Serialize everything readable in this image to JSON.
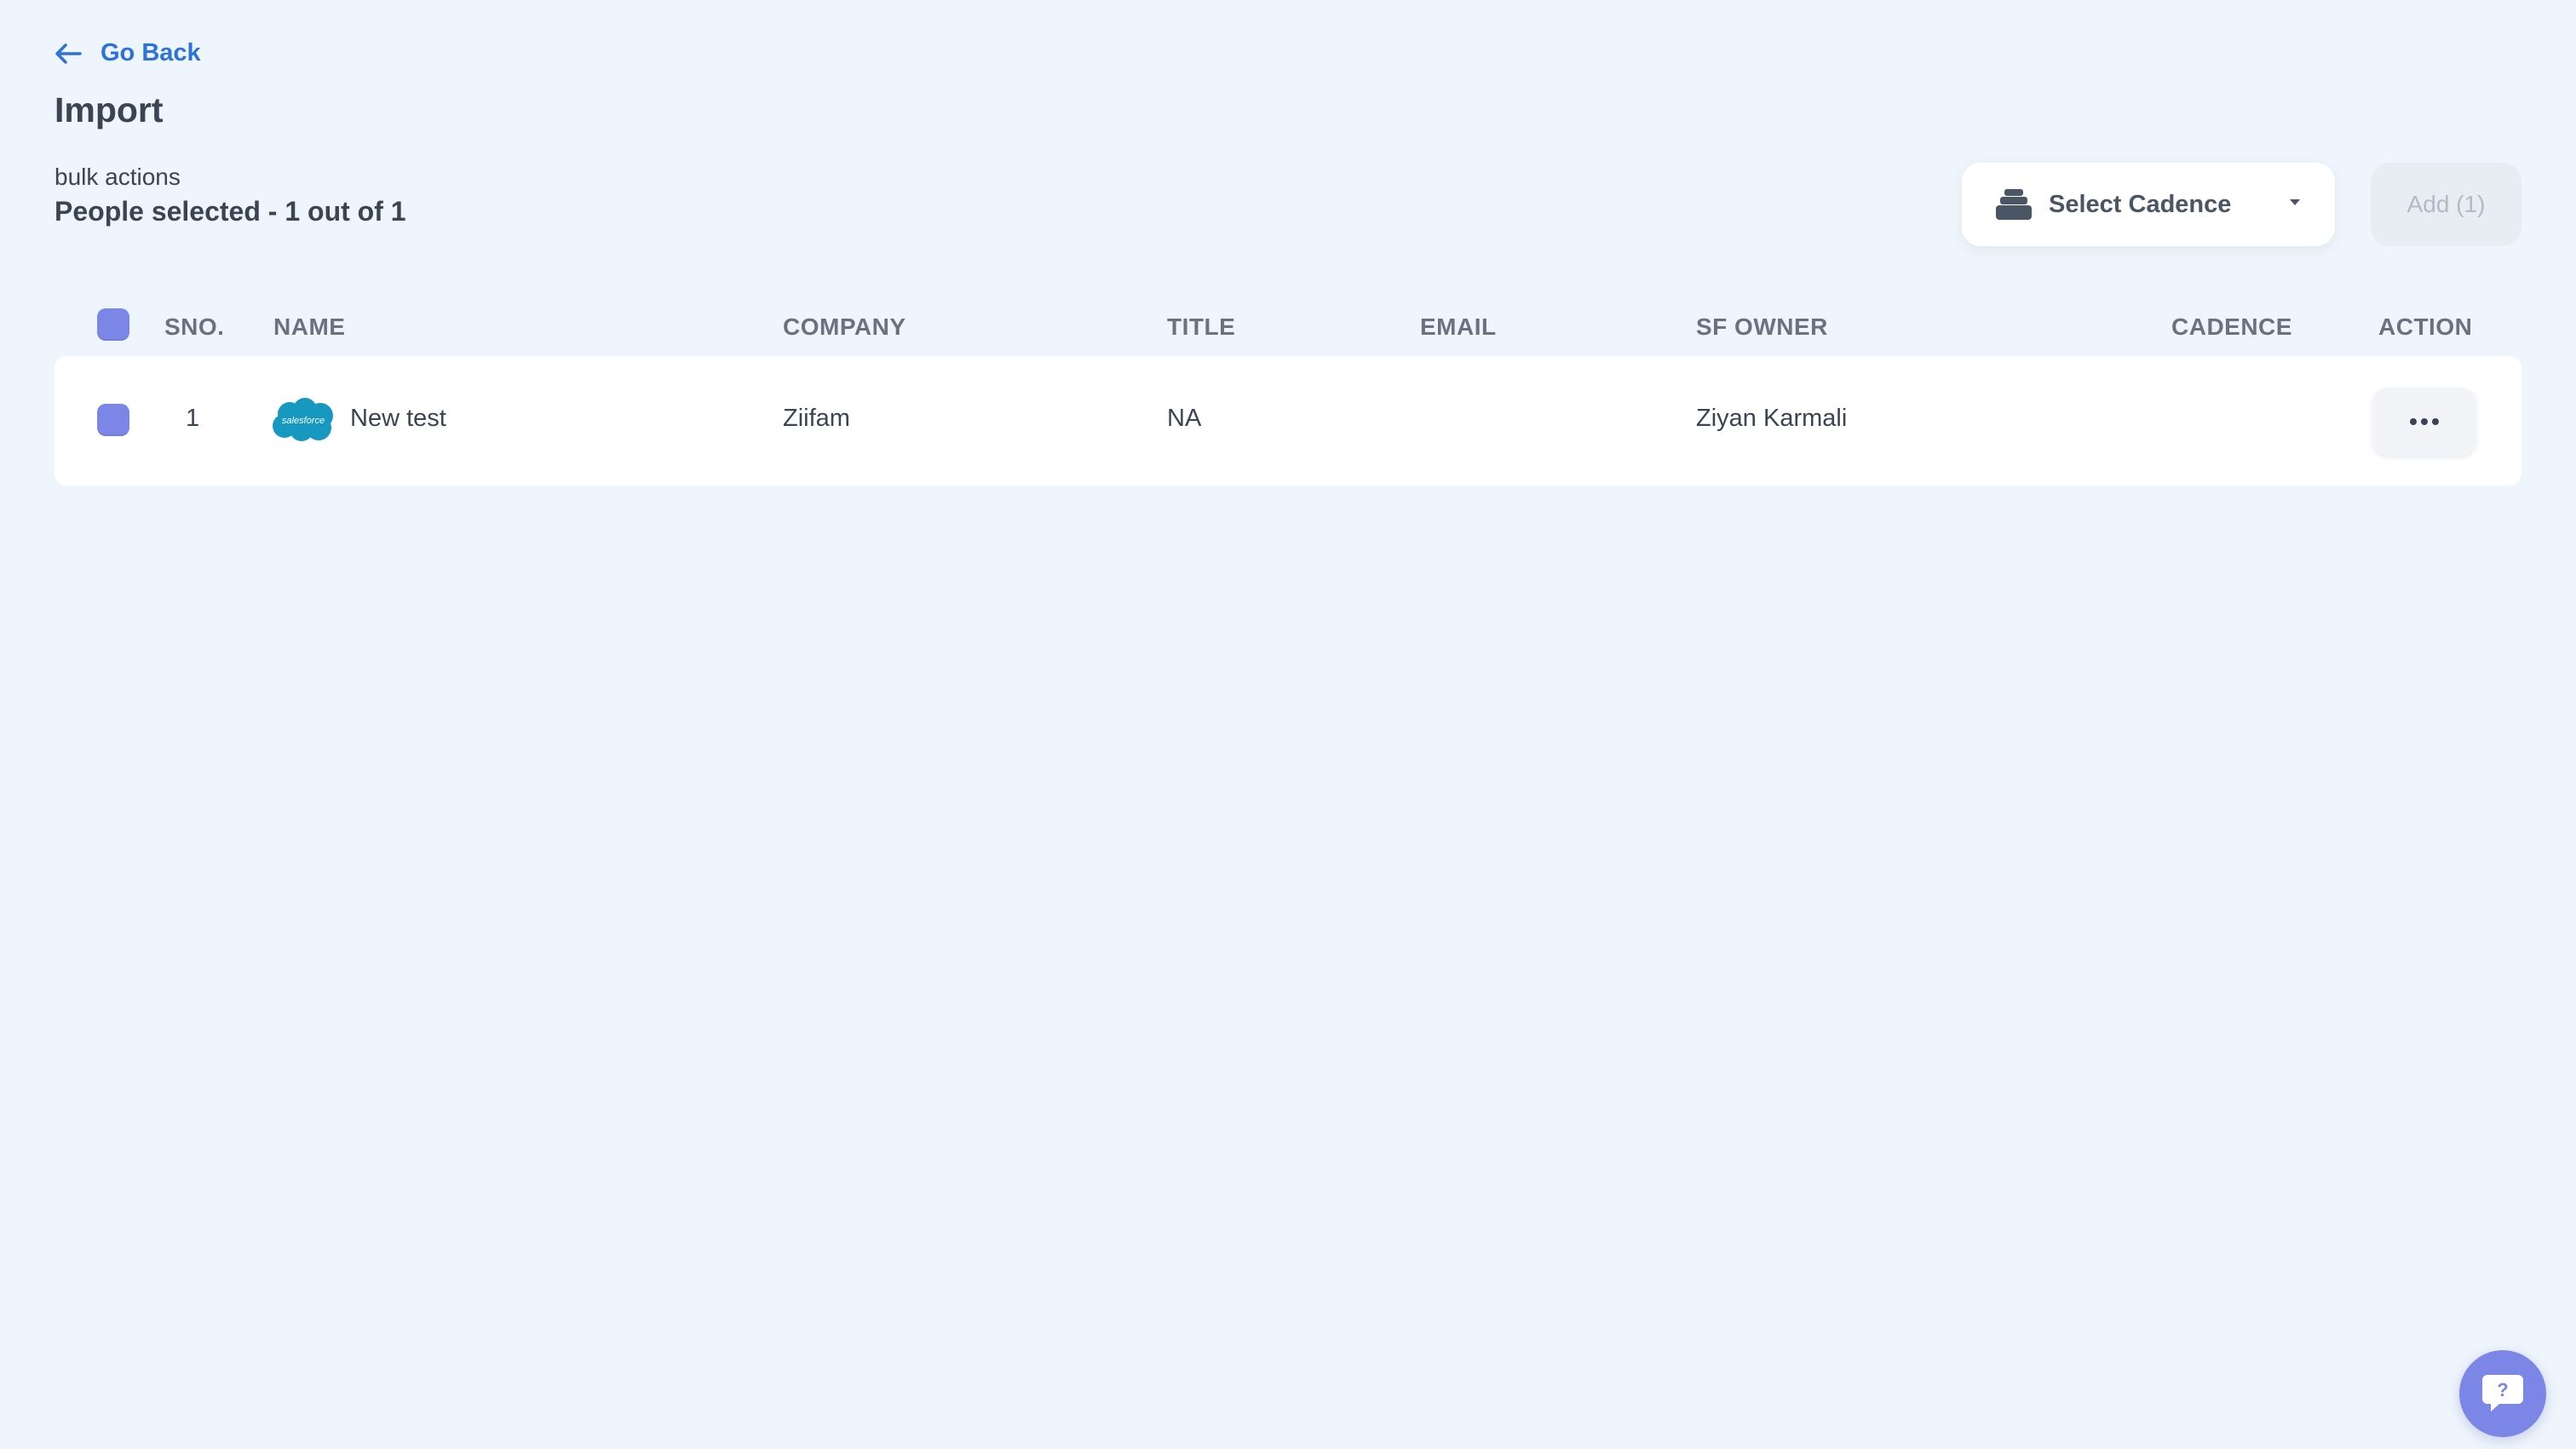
{
  "nav": {
    "back_label": "Go Back",
    "back_icon": "arrow-left-icon"
  },
  "page": {
    "title": "Import"
  },
  "selection": {
    "bulk_label": "bulk actions",
    "summary": "People selected - 1 out of 1"
  },
  "toolbar": {
    "cadence_select": {
      "label": "Select Cadence",
      "icon": "stack-icon",
      "dropdown_icon": "caret-down-icon"
    },
    "add_label": "Add (1)",
    "add_disabled": true
  },
  "table": {
    "headers": {
      "sno": "SNO.",
      "name": "NAME",
      "company": "COMPANY",
      "title": "TITLE",
      "email": "EMAIL",
      "sf_owner": "SF OWNER",
      "cadence": "CADENCE",
      "action": "ACTION"
    },
    "select_all_checked": true,
    "rows": [
      {
        "checked": true,
        "sno": "1",
        "source_icon": "salesforce-icon",
        "source_logo_text": "salesforce",
        "name": "New test",
        "company": "Ziifam",
        "title": "NA",
        "email": "",
        "sf_owner": "Ziyan Karmali",
        "cadence": "",
        "action_icon": "more-horizontal-icon"
      }
    ]
  },
  "help": {
    "icon": "help-chat-icon",
    "glyph": "?"
  },
  "colors": {
    "background": "#eef5fc",
    "accent_link": "#2b73d9",
    "checkbox": "#7c86e6",
    "salesforce_blue": "#1798c1",
    "text_primary": "#3b4453",
    "text_header": "#6a7280",
    "button_disabled_bg": "#e8edf3",
    "button_disabled_text": "#b2bac6"
  }
}
